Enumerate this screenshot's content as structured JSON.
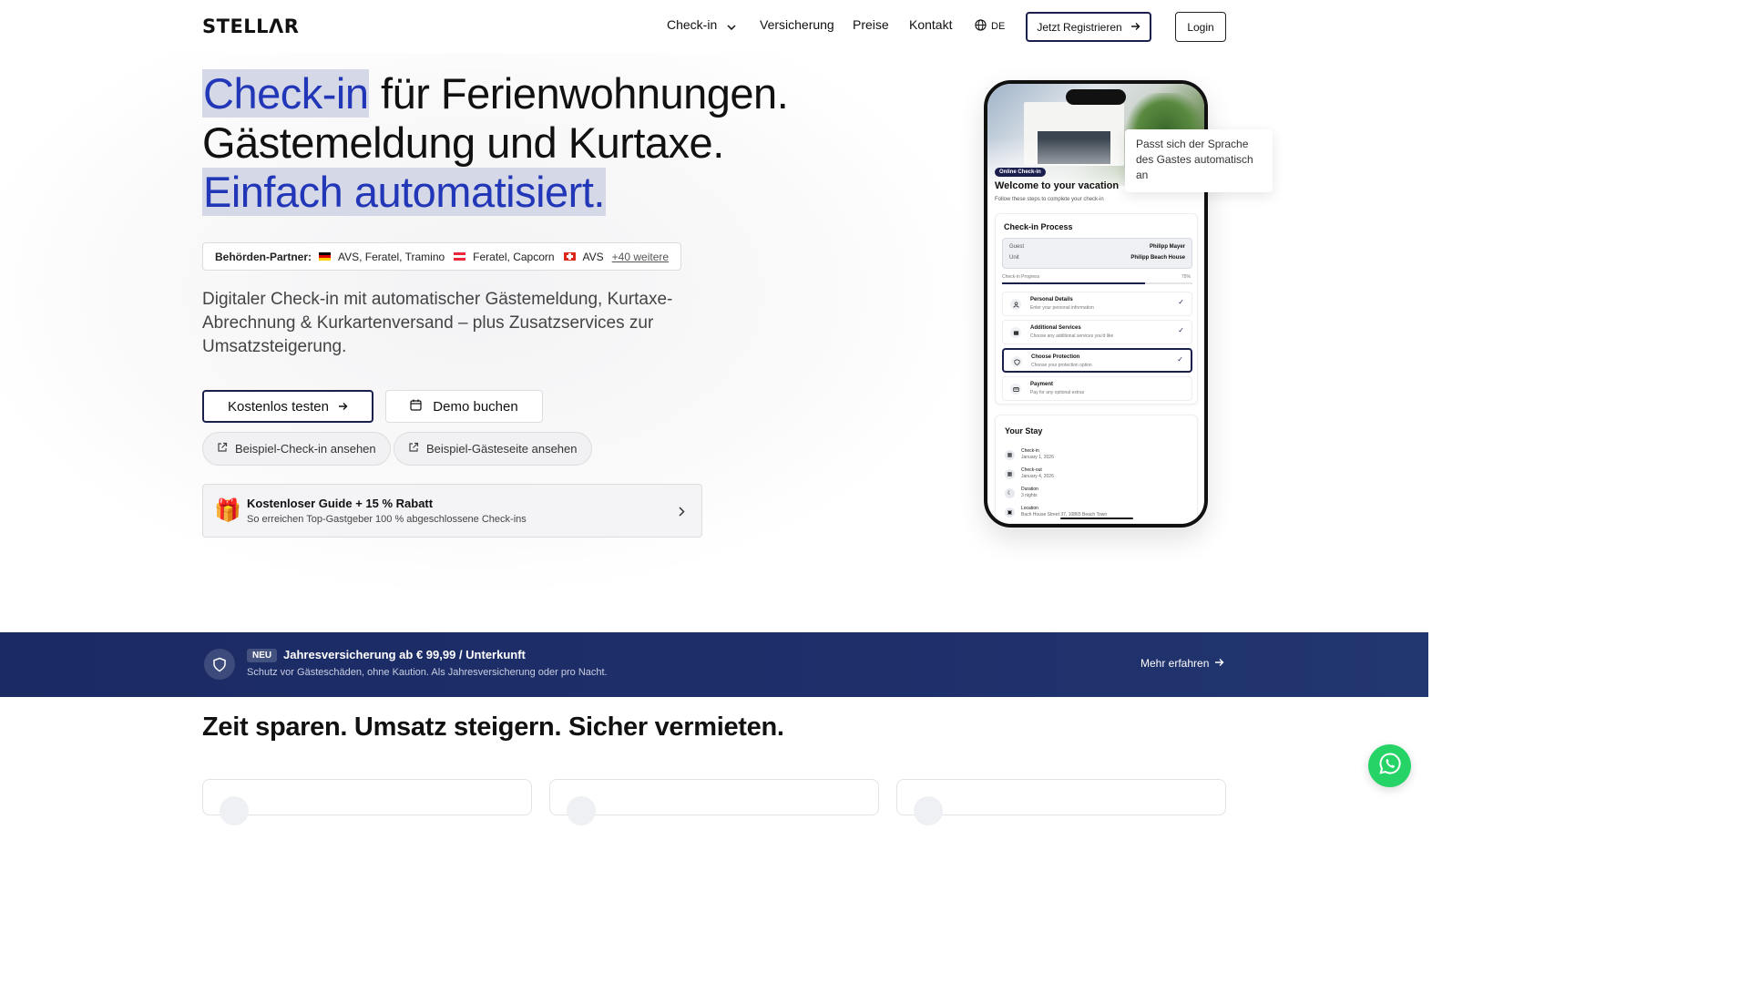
{
  "header": {
    "logo": "STELLΛR",
    "nav": [
      {
        "label": "Check-in"
      },
      {
        "label": "Versicherung"
      },
      {
        "label": "Preise"
      },
      {
        "label": "Kontakt"
      }
    ],
    "language": "DE",
    "register_label": "Jetzt Registrieren",
    "login_label": "Login"
  },
  "hero": {
    "line1_highlight": "Check-in",
    "line1_rest": " für Ferienwohnungen.",
    "line2": "Gästemeldung und Kurtaxe.",
    "line3_highlight": "Einfach automatisiert."
  },
  "partners": {
    "label": "Behörden-Partner:",
    "de": "AVS, Feratel, Tramino",
    "at": "Feratel, Capcorn",
    "ch": "AVS",
    "more": "+40 weitere"
  },
  "description": "Digitaler Check-in mit automatischer Gästemeldung, Kurtaxe-Abrechnung & Kurkartenversand – plus Zusatzservices zur Umsatzsteigerung.",
  "cta": {
    "primary": "Kostenlos testen",
    "demo": "Demo buchen",
    "example_checkin": "Beispiel-Check-in ansehen",
    "example_guestpage": "Beispiel-Gästeseite ansehen"
  },
  "guide": {
    "title": "Kostenloser Guide + 15 % Rabatt",
    "subtitle": "So erreichen Top-Gastgeber 100 % abgeschlossene Check-ins"
  },
  "phone": {
    "badge": "Online Check-in",
    "welcome": "Welcome to your vacation",
    "welcome_sub": "Follow these steps to complete your check-in",
    "checkin_title": "Check-in Process",
    "guest_label": "Guest",
    "guest_value": "Philipp Mayer",
    "unit_label": "Unit",
    "unit_value": "Philipp Beach House",
    "progress_label": "Check-in Progress",
    "progress_text": "75%",
    "progress_fraction": 0.75,
    "steps": [
      {
        "title": "Personal Details",
        "sub": "Enter your personal information"
      },
      {
        "title": "Additional Services",
        "sub": "Choose any additional services you'd like"
      },
      {
        "title": "Choose Protection",
        "sub": "Choose your protection option"
      },
      {
        "title": "Payment",
        "sub": "Pay for any optional extras"
      }
    ],
    "stay_title": "Your Stay",
    "stay": [
      {
        "label": "Check-in",
        "value": "January 1, 2026"
      },
      {
        "label": "Check-out",
        "value": "January 4, 2026"
      },
      {
        "label": "Duration",
        "value": "3 nights"
      },
      {
        "label": "Location",
        "value": "Bach House Street 37, 10865 Beach Town"
      }
    ]
  },
  "tooltip": "Passt sich der Sprache des Gastes automatisch an",
  "band": {
    "new_badge": "NEU",
    "title": "Jahresversicherung ab € 99,99 / Unterkunft",
    "subtitle": "Schutz vor Gästeschäden, ohne Kaution. Als Jahresversicherung oder pro Nacht.",
    "more": "Mehr erfahren"
  },
  "section_title": "Zeit sparen. Umsatz steigern. Sicher vermieten.",
  "colors": {
    "accent": "#2236b8",
    "navy": "#1a1f4e",
    "band": "#1e2f6a",
    "whatsapp": "#25d366"
  }
}
